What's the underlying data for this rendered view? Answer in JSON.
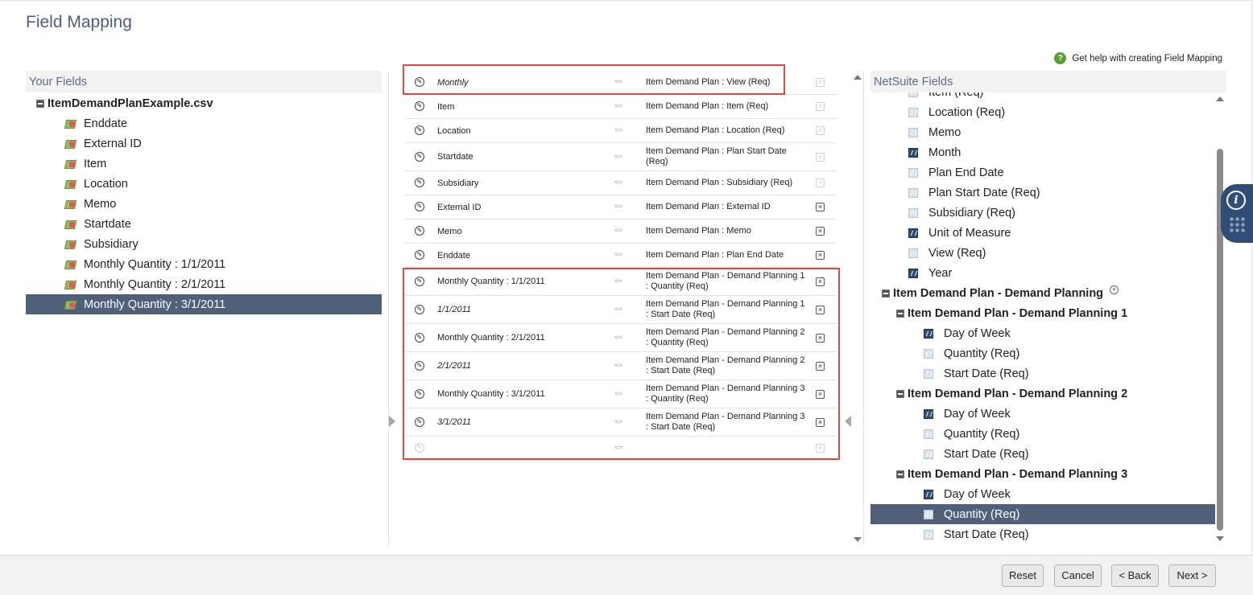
{
  "page": {
    "title": "Field Mapping",
    "help_link": "Get help with creating Field Mapping"
  },
  "your_fields": {
    "header": "Your Fields",
    "file_name": "ItemDemandPlanExample.csv",
    "items": [
      {
        "label": "Enddate"
      },
      {
        "label": "External ID"
      },
      {
        "label": "Item"
      },
      {
        "label": "Location"
      },
      {
        "label": "Memo"
      },
      {
        "label": "Startdate"
      },
      {
        "label": "Subsidiary"
      },
      {
        "label": "Monthly Quantity : 1/1/2011"
      },
      {
        "label": "Monthly Quantity : 2/1/2011"
      },
      {
        "label": "Monthly Quantity : 3/1/2011",
        "selected": true
      }
    ]
  },
  "mappings": [
    {
      "left": "Monthly",
      "right": "Item Demand Plan : View (Req)",
      "left_italic": true,
      "removable": false
    },
    {
      "left": "Item",
      "right": "Item Demand Plan : Item (Req)",
      "removable": false
    },
    {
      "left": "Location",
      "right": "Item Demand Plan : Location (Req)",
      "removable": false
    },
    {
      "left": "Startdate",
      "right": "Item Demand Plan : Plan Start Date (Req)",
      "removable": false
    },
    {
      "left": "Subsidiary",
      "right": "Item Demand Plan : Subsidiary (Req)",
      "removable": false
    },
    {
      "left": "External ID",
      "right": "Item Demand Plan : External ID",
      "removable": true
    },
    {
      "left": "Memo",
      "right": "Item Demand Plan : Memo",
      "removable": true
    },
    {
      "left": "Enddate",
      "right": "Item Demand Plan : Plan End Date",
      "removable": true
    },
    {
      "left": "Monthly Quantity : 1/1/2011",
      "right": "Item Demand Plan - Demand Planning 1 : Quantity (Req)",
      "removable": true
    },
    {
      "left": "1/1/2011",
      "right": "Item Demand Plan - Demand Planning 1 : Start Date (Req)",
      "left_italic": true,
      "removable": true
    },
    {
      "left": "Monthly Quantity : 2/1/2011",
      "right": "Item Demand Plan - Demand Planning 2 : Quantity (Req)",
      "removable": true
    },
    {
      "left": "2/1/2011",
      "right": "Item Demand Plan - Demand Planning 2 : Start Date (Req)",
      "left_italic": true,
      "removable": true
    },
    {
      "left": "Monthly Quantity : 3/1/2011",
      "right": "Item Demand Plan - Demand Planning 3 : Quantity (Req)",
      "removable": true
    },
    {
      "left": "3/1/2011",
      "right": "Item Demand Plan - Demand Planning 3 : Start Date (Req)",
      "left_italic": true,
      "removable": true
    },
    {
      "left": "",
      "right": "",
      "removable": false,
      "empty": true
    }
  ],
  "netsuite_fields": {
    "header": "NetSuite Fields",
    "rows": [
      {
        "kind": "field",
        "label": "Item (Req)",
        "icon": "light",
        "level": 1
      },
      {
        "kind": "field",
        "label": "Location (Req)",
        "icon": "light",
        "level": 1
      },
      {
        "kind": "field",
        "label": "Memo",
        "icon": "light",
        "level": 1
      },
      {
        "kind": "field",
        "label": "Month",
        "icon": "dark",
        "level": 1
      },
      {
        "kind": "field",
        "label": "Plan End Date",
        "icon": "light",
        "level": 1
      },
      {
        "kind": "field",
        "label": "Plan Start Date (Req)",
        "icon": "light",
        "level": 1
      },
      {
        "kind": "field",
        "label": "Subsidiary (Req)",
        "icon": "light",
        "level": 1
      },
      {
        "kind": "field",
        "label": "Unit of Measure",
        "icon": "dark",
        "level": 1
      },
      {
        "kind": "field",
        "label": "View (Req)",
        "icon": "light",
        "level": 1
      },
      {
        "kind": "field",
        "label": "Year",
        "icon": "dark",
        "level": 1
      },
      {
        "kind": "group",
        "label": "Item Demand Plan - Demand Planning",
        "level": 0,
        "has_add": true
      },
      {
        "kind": "group",
        "label": "Item Demand Plan - Demand Planning 1",
        "level": 1
      },
      {
        "kind": "field",
        "label": "Day of Week",
        "icon": "dark",
        "level": 2
      },
      {
        "kind": "field",
        "label": "Quantity (Req)",
        "icon": "light",
        "level": 2
      },
      {
        "kind": "field",
        "label": "Start Date (Req)",
        "icon": "light",
        "level": 2
      },
      {
        "kind": "group",
        "label": "Item Demand Plan - Demand Planning 2",
        "level": 1
      },
      {
        "kind": "field",
        "label": "Day of Week",
        "icon": "dark",
        "level": 2
      },
      {
        "kind": "field",
        "label": "Quantity (Req)",
        "icon": "light",
        "level": 2
      },
      {
        "kind": "field",
        "label": "Start Date (Req)",
        "icon": "light",
        "level": 2
      },
      {
        "kind": "group",
        "label": "Item Demand Plan - Demand Planning 3",
        "level": 1
      },
      {
        "kind": "field",
        "label": "Day of Week",
        "icon": "dark",
        "level": 2
      },
      {
        "kind": "field",
        "label": "Quantity (Req)",
        "icon": "light",
        "level": 2,
        "selected": true
      },
      {
        "kind": "field",
        "label": "Start Date (Req)",
        "icon": "light",
        "level": 2
      }
    ]
  },
  "footer": {
    "reset": "Reset",
    "cancel": "Cancel",
    "back": "< Back",
    "next": "Next >"
  },
  "colors": {
    "selected_row": "#4f6078",
    "highlight_box": "#e04848",
    "header_text": "#5d6d86"
  }
}
